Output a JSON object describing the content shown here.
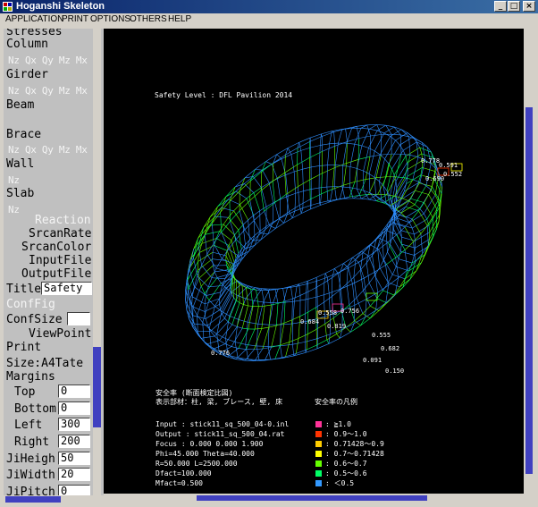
{
  "window": {
    "title": "Hoganshi Skeleton"
  },
  "menu": [
    "APPLICATION",
    "PRINT",
    "OPTIONS",
    "OTHERS",
    "HELP"
  ],
  "left_panel": {
    "stresses": "Stresses",
    "column": "Column",
    "column_items": "Nz Qx Qy Mz Mx",
    "girder": "Girder",
    "girder_items": "Nz Qx Qy Mz Mx",
    "beam": "Beam",
    "brace": "Brace",
    "brace_items": "Nz Qx Qy Mz Mx",
    "wall": "Wall",
    "wall_items": "Nz",
    "slab": "Slab",
    "slab_items": "Nz",
    "reaction": "Reaction",
    "srcan_rate": "SrcanRate",
    "srcan_color": "SrcanColor",
    "input_file": "InputFile",
    "output_file": "OutputFile",
    "title_label": "Title",
    "title_value": "Safety",
    "conf_fig": "ConfFig",
    "conf_size": "ConfSize",
    "conf_size_value": "",
    "view_point": "ViewPoint",
    "print": "Print",
    "size": "Size:A4Tate",
    "margins": "Margins",
    "top_label": "Top",
    "top_value": "0",
    "bottom_label": "Bottom",
    "bottom_value": "0",
    "left_label": "Left",
    "left_value": "300",
    "right_label": "Right",
    "right_value": "200",
    "ji_height_label": "JiHeigh",
    "ji_height_value": "50",
    "ji_width_label": "JiWidth",
    "ji_width_value": "20",
    "ji_pitch_label": "JiPitch",
    "ji_pitch_value": "0"
  },
  "canvas": {
    "heading": "Safety Level : DFL Pavilion 2014",
    "info_title": "安全率 (断面検定比図)",
    "info_members": "表示部材：柱, 梁, ブレース, 壁, 床",
    "input": "Input  : stick11_sq_500_04-0.inl",
    "output": "Output : stick11_sq_500_04.rat",
    "focus": "Focus : 0.000 0.000 1.900",
    "phi_theta": "Phi=45.000 Theta=40.000",
    "r_l": "R=50.000 L=2500.000",
    "dfact": "Dfact=100.000",
    "mfact": "Mfact=0.500",
    "legend_title": "安全率の凡例",
    "legend": [
      {
        "label": ": ≧1.0",
        "color": "#ff3399"
      },
      {
        "label": ": 0.9～1.0",
        "color": "#ff3300"
      },
      {
        "label": ": 0.71428～0.9",
        "color": "#ffcc00"
      },
      {
        "label": ": 0.7～0.71428",
        "color": "#ffff00"
      },
      {
        "label": ": 0.6～0.7",
        "color": "#66ff00"
      },
      {
        "label": ": 0.5～0.6",
        "color": "#00ff66"
      },
      {
        "label": ": ＜0.5",
        "color": "#3399ff"
      }
    ],
    "labels": [
      "0.778",
      "0.690",
      "0.591",
      "0.552",
      "0.684",
      "0.558",
      "0.819",
      "0.756",
      "0.555",
      "0.682",
      "0.150",
      "0.091",
      "0.776"
    ]
  }
}
